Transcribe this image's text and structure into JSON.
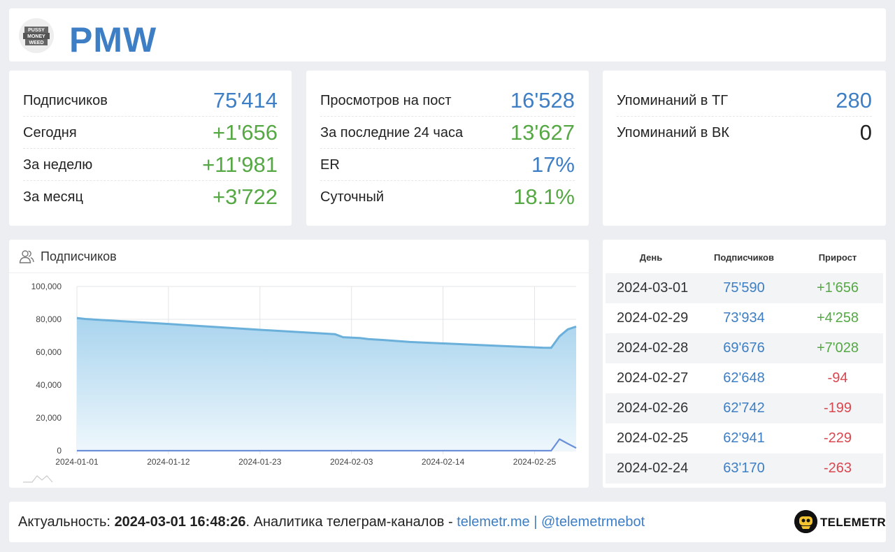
{
  "header": {
    "title": "PMW",
    "logo_text": "PUSSY MONEY WEED"
  },
  "cards": [
    {
      "rows": [
        {
          "label": "Подписчиков",
          "value": "75'414",
          "color": "blue"
        },
        {
          "label": "Сегодня",
          "value": "+1'656",
          "color": "green"
        },
        {
          "label": "За неделю",
          "value": "+11'981",
          "color": "green"
        },
        {
          "label": "За месяц",
          "value": "+3'722",
          "color": "green"
        }
      ]
    },
    {
      "rows": [
        {
          "label": "Просмотров на пост",
          "value": "16'528",
          "color": "blue"
        },
        {
          "label": "За последние 24 часа",
          "value": "13'627",
          "color": "green"
        },
        {
          "label": "ER",
          "value": "17%",
          "color": "blue"
        },
        {
          "label": "Суточный",
          "value": "18.1%",
          "color": "green"
        }
      ]
    },
    {
      "rows": [
        {
          "label": "Упоминаний в ТГ",
          "value": "280",
          "color": "blue"
        },
        {
          "label": "Упоминаний в ВК",
          "value": "0",
          "color": "dark"
        }
      ]
    }
  ],
  "chart_title": "Подписчиков",
  "chart_data": {
    "type": "area",
    "y_ticks": [
      "100,000",
      "80,000",
      "60,000",
      "40,000",
      "20,000",
      "0"
    ],
    "x_ticks": [
      "2024-01-01",
      "2024-01-12",
      "2024-01-23",
      "2024-02-03",
      "2024-02-14",
      "2024-02-25"
    ],
    "ylim": [
      0,
      100000
    ],
    "grid": true,
    "series": [
      {
        "values": [
          [
            "2024-01-01",
            80800
          ],
          [
            "2024-01-02",
            80200
          ],
          [
            "2024-01-03",
            79900
          ],
          [
            "2024-01-12",
            77200
          ],
          [
            "2024-01-23",
            73600
          ],
          [
            "2024-02-01",
            71000
          ],
          [
            "2024-02-02",
            69100
          ],
          [
            "2024-02-04",
            68600
          ],
          [
            "2024-02-05",
            68000
          ],
          [
            "2024-02-07",
            67300
          ],
          [
            "2024-02-10",
            66200
          ],
          [
            "2024-02-14",
            65300
          ],
          [
            "2024-02-20",
            64000
          ],
          [
            "2024-02-24",
            63170
          ],
          [
            "2024-02-25",
            62941
          ],
          [
            "2024-02-26",
            62742
          ],
          [
            "2024-02-27",
            62648
          ],
          [
            "2024-02-28",
            69676
          ],
          [
            "2024-02-29",
            73934
          ],
          [
            "2024-03-01",
            75590
          ]
        ]
      },
      {
        "values": [
          [
            "2024-01-01",
            0
          ],
          [
            "2024-02-25",
            0
          ],
          [
            "2024-02-26",
            0
          ],
          [
            "2024-02-27",
            0
          ],
          [
            "2024-02-28",
            7028
          ],
          [
            "2024-02-29",
            4258
          ],
          [
            "2024-03-01",
            1656
          ]
        ]
      }
    ]
  },
  "table": {
    "headers": [
      "День",
      "Подписчиков",
      "Прирост"
    ],
    "rows": [
      {
        "day": "2024-03-01",
        "subs": "75'590",
        "growth": "+1'656",
        "color": "green"
      },
      {
        "day": "2024-02-29",
        "subs": "73'934",
        "growth": "+4'258",
        "color": "green"
      },
      {
        "day": "2024-02-28",
        "subs": "69'676",
        "growth": "+7'028",
        "color": "green"
      },
      {
        "day": "2024-02-27",
        "subs": "62'648",
        "growth": "-94",
        "color": "red"
      },
      {
        "day": "2024-02-26",
        "subs": "62'742",
        "growth": "-199",
        "color": "red"
      },
      {
        "day": "2024-02-25",
        "subs": "62'941",
        "growth": "-229",
        "color": "red"
      },
      {
        "day": "2024-02-24",
        "subs": "63'170",
        "growth": "-263",
        "color": "red"
      }
    ]
  },
  "footer": {
    "prefix": "Актуальность: ",
    "timestamp": "2024-03-01 16:48:26",
    "middle": ". Аналитика телеграм-каналов - ",
    "link1": "telemetr.me",
    "sep": " | ",
    "link2": "@telemetrmebot",
    "brand": "TELEMETR"
  },
  "colors": {
    "accent": "#3d7ec4",
    "green": "#55a844",
    "red": "#d9474f",
    "area_line": "#6ab0da",
    "growth_line": "#6b8fd9"
  }
}
